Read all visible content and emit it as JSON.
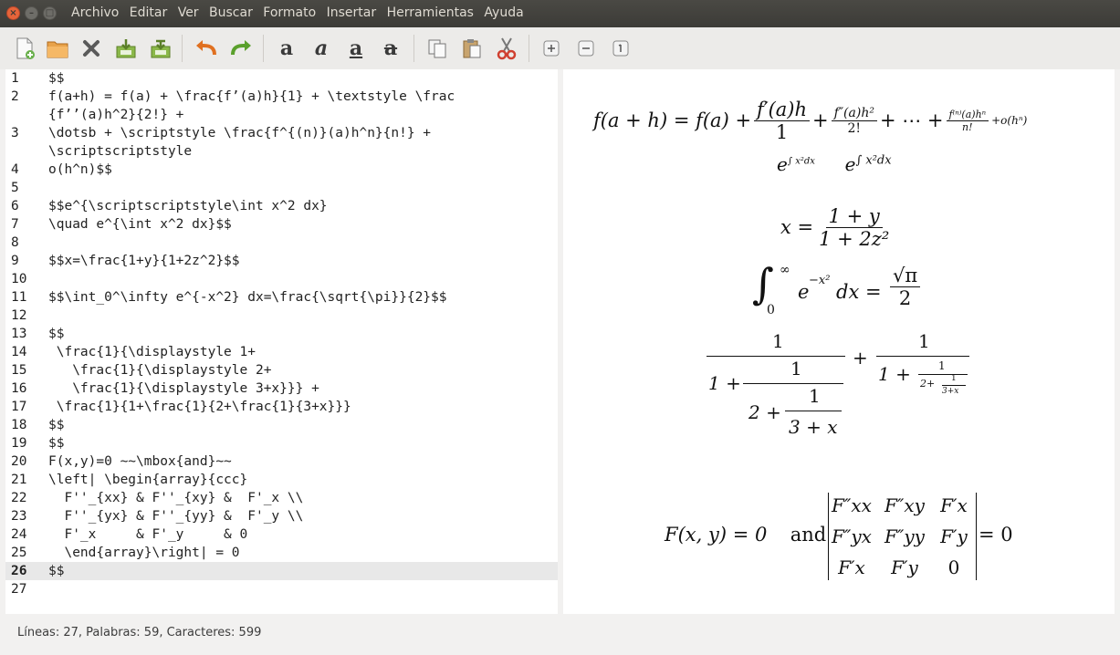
{
  "window": {
    "controls": [
      "close-icon",
      "minimize-icon",
      "maximize-icon"
    ]
  },
  "menu": [
    "Archivo",
    "Editar",
    "Ver",
    "Buscar",
    "Formato",
    "Insertar",
    "Herramientas",
    "Ayuda"
  ],
  "toolbar": {
    "buttons": [
      "new-file-icon",
      "open-file-icon",
      "close-doc-icon",
      "save-icon",
      "save-as-icon",
      "undo-icon",
      "redo-icon",
      "bold-icon",
      "italic-icon",
      "underline-icon",
      "strikethrough-icon",
      "copy-icon",
      "paste-icon",
      "cut-icon",
      "zoom-in-icon",
      "zoom-out-icon",
      "zoom-reset-icon"
    ],
    "format_letters": [
      "a",
      "a",
      "a",
      "a"
    ]
  },
  "editor": {
    "lines": [
      {
        "n": "1",
        "t": "$$"
      },
      {
        "n": "2",
        "t": "f(a+h) = f(a) + \\frac{f’(a)h}{1} + \\textstyle \\frac"
      },
      {
        "n": "",
        "t": "{f’’(a)h^2}{2!} +"
      },
      {
        "n": "3",
        "t": "\\dotsb + \\scriptstyle \\frac{f^{(n)}(a)h^n}{n!} +"
      },
      {
        "n": "",
        "t": "\\scriptscriptstyle"
      },
      {
        "n": "4",
        "t": "o(h^n)$$"
      },
      {
        "n": "5",
        "t": ""
      },
      {
        "n": "6",
        "t": "$$e^{\\scriptscriptstyle\\int x^2 dx}"
      },
      {
        "n": "7",
        "t": "\\quad e^{\\int x^2 dx}$$"
      },
      {
        "n": "8",
        "t": ""
      },
      {
        "n": "9",
        "t": "$$x=\\frac{1+y}{1+2z^2}$$"
      },
      {
        "n": "10",
        "t": ""
      },
      {
        "n": "11",
        "t": "$$\\int_0^\\infty e^{-x^2} dx=\\frac{\\sqrt{\\pi}}{2}$$"
      },
      {
        "n": "12",
        "t": ""
      },
      {
        "n": "13",
        "t": "$$"
      },
      {
        "n": "14",
        "t": " \\frac{1}{\\displaystyle 1+"
      },
      {
        "n": "15",
        "t": "   \\frac{1}{\\displaystyle 2+"
      },
      {
        "n": "16",
        "t": "   \\frac{1}{\\displaystyle 3+x}}} +"
      },
      {
        "n": "17",
        "t": " \\frac{1}{1+\\frac{1}{2+\\frac{1}{3+x}}}"
      },
      {
        "n": "18",
        "t": "$$"
      },
      {
        "n": "19",
        "t": "$$"
      },
      {
        "n": "20",
        "t": "F(x,y)=0 ~~\\mbox{and}~~"
      },
      {
        "n": "21",
        "t": "\\left| \\begin{array}{ccc}"
      },
      {
        "n": "22",
        "t": "  F''_{xx} & F''_{xy} &  F'_x \\\\"
      },
      {
        "n": "23",
        "t": "  F''_{yx} & F''_{yy} &  F'_y \\\\"
      },
      {
        "n": "24",
        "t": "  F'_x     & F'_y     & 0"
      },
      {
        "n": "25",
        "t": "  \\end{array}\\right| = 0"
      },
      {
        "n": "26",
        "t": "$$"
      },
      {
        "n": "27",
        "t": ""
      }
    ],
    "current_line": "26"
  },
  "preview": {
    "eq1": {
      "lhs": "f(a + h) = f(a) +",
      "n1": "f′(a)h",
      "d1": "1",
      "n2": "f″(a)h²",
      "d2": "2!",
      "mid": "+ ⋯ +",
      "n3": "f⁽ⁿ⁾(a)hⁿ",
      "d3": "n!",
      "tail": "+o(hⁿ)"
    },
    "eq2": {
      "a": "e",
      "a_sup": "∫ x²dx",
      "b": "e",
      "b_sup": "∫ x²dx"
    },
    "eq3": {
      "lhs": "x =",
      "num": "1 + y",
      "den": "1 + 2z²"
    },
    "eq4": {
      "int": "∫",
      "upper": "∞",
      "lower": "0",
      "body": "e",
      "sup": "−x²",
      "dx": "dx =",
      "num": "√π",
      "den": "2"
    },
    "eq5": {
      "one": "1",
      "a1": "1 +",
      "a2": "2 +",
      "a3": "3 + x",
      "plus": "+",
      "s1": "1 +",
      "s2": "2+",
      "s3": "3+x"
    },
    "eq6": {
      "lhs": "F(x, y) = 0",
      "and": "and",
      "rhs": "= 0",
      "cells": [
        [
          "F″xx",
          "F″xy",
          "F′x"
        ],
        [
          "F″yx",
          "F″yy",
          "F′y"
        ],
        [
          "F′x",
          "F′y",
          "0"
        ]
      ]
    }
  },
  "status": "Líneas: 27, Palabras: 59, Caracteres: 599",
  "colors": {
    "titlebar": "#3c3b37",
    "close": "#e6643a",
    "backslash_blue": "#2a34c8",
    "current_line": "#e8e8e8"
  }
}
